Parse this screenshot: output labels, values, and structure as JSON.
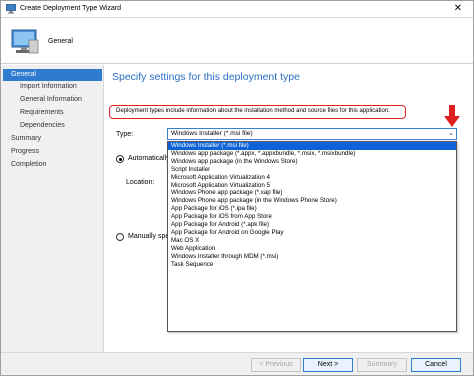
{
  "window": {
    "title": "Create Deployment Type Wizard",
    "close_glyph": "✕"
  },
  "header": {
    "title": "General"
  },
  "nav": {
    "items": [
      {
        "label": "General",
        "level": "top",
        "active": true
      },
      {
        "label": "Import Information",
        "level": "sub",
        "active": false
      },
      {
        "label": "General Information",
        "level": "sub",
        "active": false
      },
      {
        "label": "Requirements",
        "level": "sub",
        "active": false
      },
      {
        "label": "Dependencies",
        "level": "sub",
        "active": false
      },
      {
        "label": "Summary",
        "level": "top",
        "active": false
      },
      {
        "label": "Progress",
        "level": "top",
        "active": false
      },
      {
        "label": "Completion",
        "level": "top",
        "active": false
      }
    ]
  },
  "main": {
    "heading": "Specify settings for this deployment type",
    "info_text": "Deployment types include information about the installation method and source files for this application.",
    "type_label": "Type:",
    "type_value": "Windows Installer (*.msi file)",
    "dropdown_options": [
      "Windows Installer (*.msi file)",
      "Windows app package (*.appx, *.appxbundle, *.msix, *.msixbundle)",
      "Windows app package (in the Windows Store)",
      "Script Installer",
      "Microsoft Application Virtualization 4",
      "Microsoft Application Virtualization 5",
      "Windows Phone app package (*.xap file)",
      "Windows Phone app package (in the Windows Phone Store)",
      "App Package for iOS (*.ipa file)",
      "App Package for iOS from App Store",
      "App Package for Android (*.apk file)",
      "App Package for Android on Google Play",
      "Mac OS X",
      "Web Application",
      "Windows Installer through MDM (*.msi)",
      "Task Sequence"
    ],
    "selected_index": 0,
    "radio_auto_label": "Automatically i",
    "location_label": "Location:",
    "radio_manual_label": "Manually spec"
  },
  "footer": {
    "previous": "< Previous",
    "next": "Next >",
    "summary": "Summary",
    "cancel": "Cancel"
  },
  "colors": {
    "accent": "#2e7bcf",
    "heading": "#2a6fc2",
    "selection": "#0a64d8",
    "highlight_border": "#e02020",
    "arrow": "#e02020"
  },
  "icons": {
    "title": "computer-icon",
    "header": "computer-icon",
    "arrow": "red-arrow-down-icon",
    "chevron": "chevron-down-icon"
  }
}
